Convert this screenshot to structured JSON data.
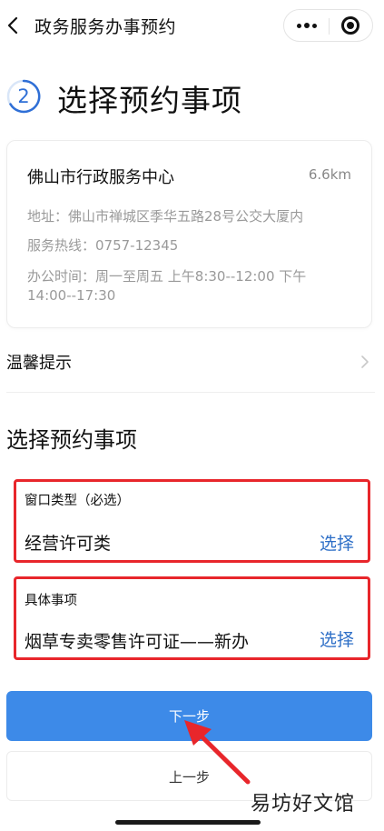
{
  "navbar": {
    "title": "政务服务办事预约"
  },
  "step": {
    "number": "2",
    "title": "选择预约事项"
  },
  "center": {
    "name": "佛山市行政服务中心",
    "distance": "6.6km",
    "address": "地址：佛山市禅城区季华五路28号公交大厦内",
    "hotline": "服务热线：0757-12345",
    "hours_line1": "办公时间：周一至周五 上午8:30--12:00 下午",
    "hours_line2": "14:00--17:30"
  },
  "tips": {
    "label": "温馨提示"
  },
  "section": {
    "title": "选择预约事项"
  },
  "window_type": {
    "label": "窗口类型（必选）",
    "value": "经营许可类",
    "action": "选择"
  },
  "specific_item": {
    "label": "具体事项",
    "value": "烟草专卖零售许可证——新办",
    "action": "选择"
  },
  "buttons": {
    "next": "下一步",
    "prev": "上一步"
  },
  "watermark": "易坊好文馆",
  "colors": {
    "accent": "#3d8ae8",
    "link": "#2e6fc7",
    "highlight_border": "#e8262b"
  }
}
